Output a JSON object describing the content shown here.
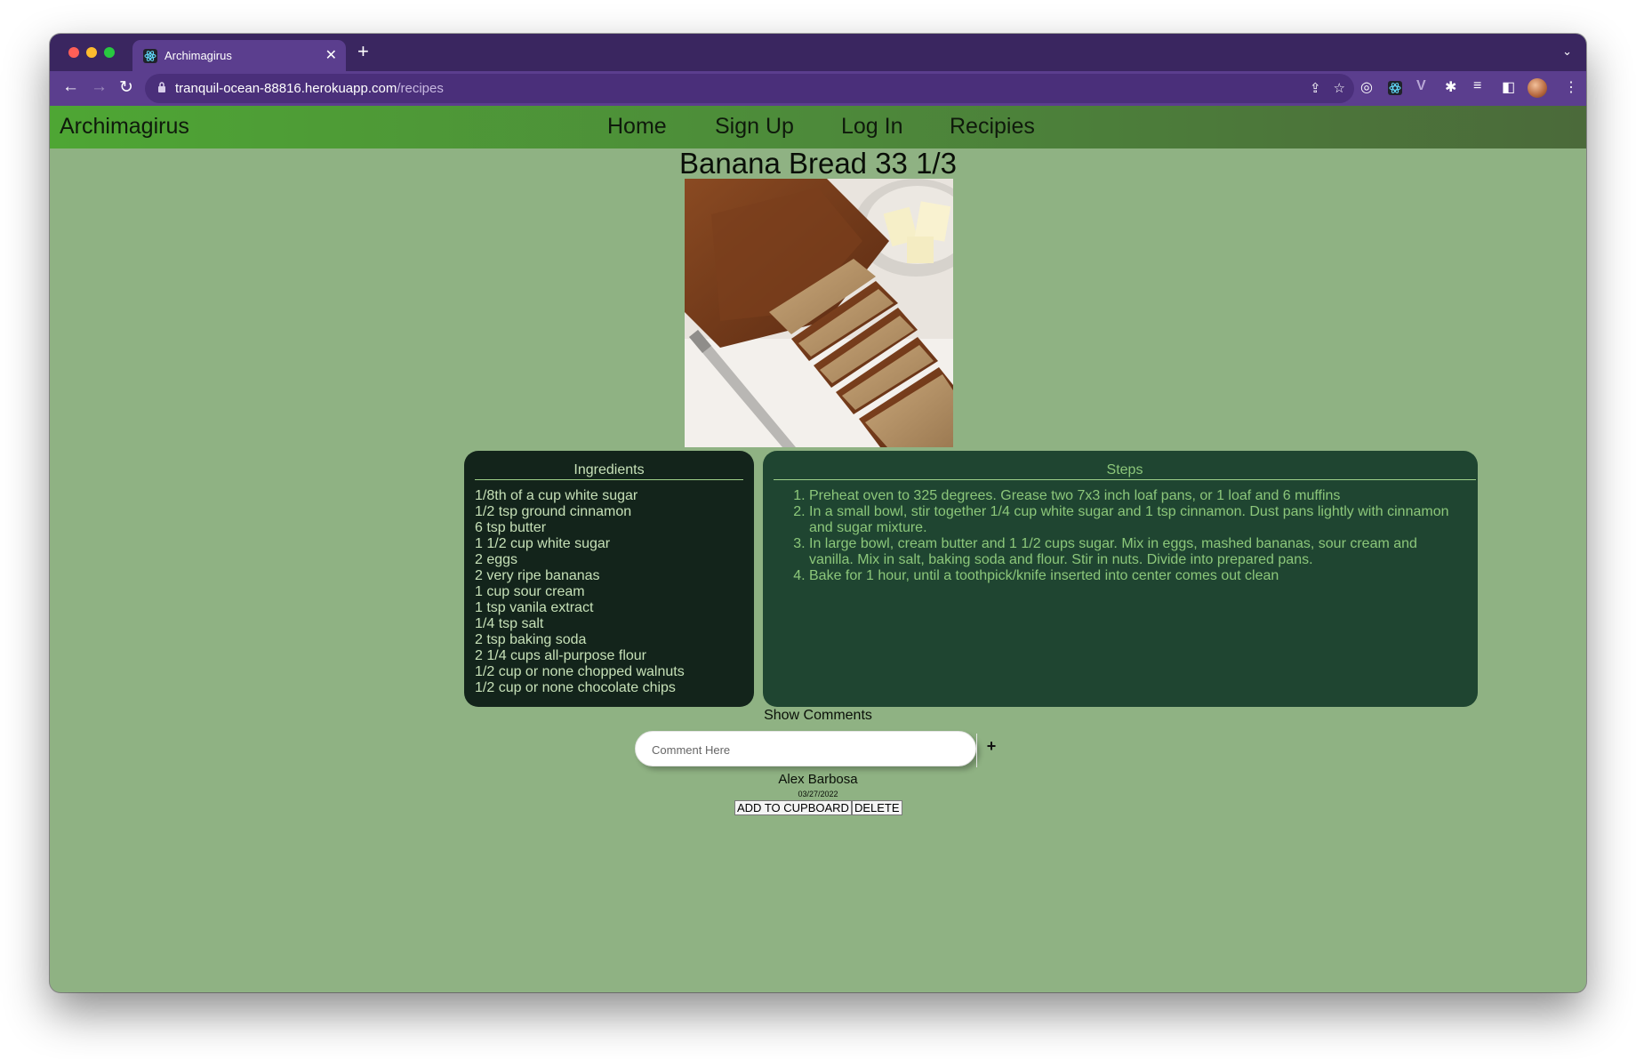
{
  "browser": {
    "tab_title": "Archimagirus",
    "url_host": "tranquil-ocean-88816.herokuapp.com",
    "url_path": "/recipes",
    "traffic_lights": [
      "#ff5f57",
      "#febc2e",
      "#28c840"
    ]
  },
  "nav": {
    "brand": "Archimagirus",
    "links": [
      "Home",
      "Sign Up",
      "Log In",
      "Recipies"
    ]
  },
  "recipe": {
    "title": "Banana Bread 33 1/3",
    "ingredients_heading": "Ingredients",
    "ingredients": [
      "1/8th of a cup white sugar",
      "1/2 tsp ground cinnamon",
      "6 tsp butter",
      "1 1/2 cup white sugar",
      "2 eggs",
      "2 very ripe bananas",
      "1 cup sour cream",
      "1 tsp vanila extract",
      "1/4 tsp salt",
      "2 tsp baking soda",
      "2 1/4 cups all-purpose flour",
      "1/2 cup or none chopped walnuts",
      "1/2 cup or none chocolate chips"
    ],
    "steps_heading": "Steps",
    "steps": [
      "Preheat oven to 325 degrees. Grease two 7x3 inch loaf pans, or 1 loaf and 6 muffins",
      "In a small bowl, stir together 1/4 cup white sugar and 1 tsp cinnamon. Dust pans lightly with cinnamon and sugar mixture.",
      "In large bowl, cream butter and 1 1/2 cups sugar. Mix in eggs, mashed bananas, sour cream and vanilla. Mix in salt, baking soda and flour. Stir in nuts. Divide into prepared pans.",
      "Bake for 1 hour, until a toothpick/knife inserted into center comes out clean"
    ]
  },
  "comments": {
    "toggle_label": "Show Comments",
    "placeholder": "Comment Here",
    "add_label": "+"
  },
  "author": {
    "name": "Alex Barbosa",
    "date": "03/27/2022"
  },
  "actions": {
    "add_to_cupboard": "ADD TO CUPBOARD",
    "delete": "DELETE"
  }
}
